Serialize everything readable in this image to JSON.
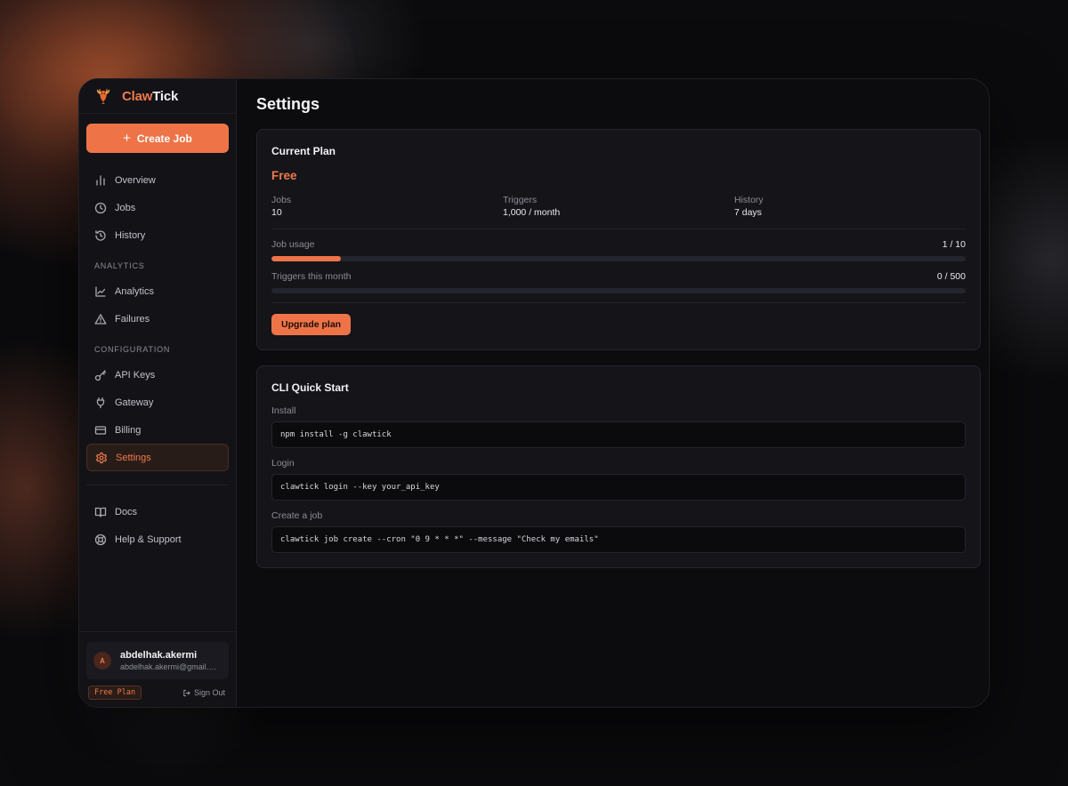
{
  "brand": {
    "part1": "Claw",
    "part2": "Tick"
  },
  "sidebar": {
    "create_label": "Create Job",
    "main_items": [
      {
        "label": "Overview",
        "icon": "bar-chart-icon"
      },
      {
        "label": "Jobs",
        "icon": "clock-icon"
      },
      {
        "label": "History",
        "icon": "history-icon"
      }
    ],
    "analytics_section": "ANALYTICS",
    "analytics_items": [
      {
        "label": "Analytics",
        "icon": "line-chart-icon"
      },
      {
        "label": "Failures",
        "icon": "warning-icon"
      }
    ],
    "config_section": "CONFIGURATION",
    "config_items": [
      {
        "label": "API Keys",
        "icon": "key-icon"
      },
      {
        "label": "Gateway",
        "icon": "plug-icon"
      },
      {
        "label": "Billing",
        "icon": "credit-card-icon"
      },
      {
        "label": "Settings",
        "icon": "gear-icon",
        "active": true
      }
    ],
    "footer_items": [
      {
        "label": "Docs",
        "icon": "book-icon"
      },
      {
        "label": "Help & Support",
        "icon": "lifebuoy-icon"
      }
    ]
  },
  "user": {
    "initial": "A",
    "name": "abdelhak.akermi",
    "email": "abdelhak.akermi@gmail.com",
    "plan_badge": "Free Plan",
    "signout_label": "Sign Out"
  },
  "page": {
    "title": "Settings",
    "plan_card": {
      "title": "Current Plan",
      "plan_name": "Free",
      "stats": [
        {
          "label": "Jobs",
          "value": "10"
        },
        {
          "label": "Triggers",
          "value": "1,000 / month"
        },
        {
          "label": "History",
          "value": "7 days"
        }
      ],
      "job_usage": {
        "label": "Job usage",
        "value": "1 / 10",
        "fraction": 0.1
      },
      "trigger_usage": {
        "label": "Triggers this month",
        "value": "0 / 500",
        "fraction": 0
      },
      "upgrade_label": "Upgrade plan"
    },
    "cli_card": {
      "title": "CLI Quick Start",
      "steps": [
        {
          "label": "Install",
          "command": "npm install -g clawtick"
        },
        {
          "label": "Login",
          "command": "clawtick login --key your_api_key"
        },
        {
          "label": "Create a job",
          "command": "clawtick job create --cron \"0 9 * * *\" --message \"Check my emails\""
        }
      ]
    }
  },
  "colors": {
    "accent": "#ee7448",
    "background": "#0c0c0f"
  }
}
